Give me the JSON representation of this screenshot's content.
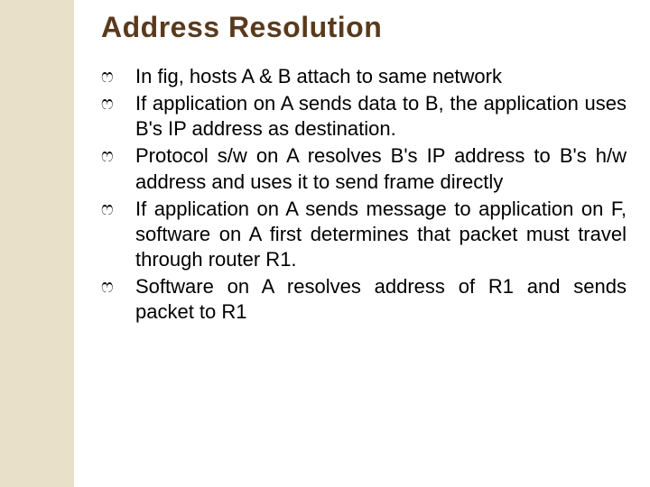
{
  "title": "Address Resolution",
  "bullet_marker": "ෆ",
  "bullets": [
    {
      "text": "In fig, hosts A & B attach to same network",
      "justify": false
    },
    {
      "text": "If application on A sends data to B, the application uses B's IP address as destination.",
      "justify": true
    },
    {
      "text": "Protocol s/w on A resolves B's IP address to B's h/w address and uses it to send frame directly",
      "justify": true
    },
    {
      "text": "If application on A sends message to application on F, software on A first determines that packet must travel through router R1.",
      "justify": true
    },
    {
      "text": "Software on A resolves address of R1 and sends packet to R1",
      "justify": true
    }
  ]
}
